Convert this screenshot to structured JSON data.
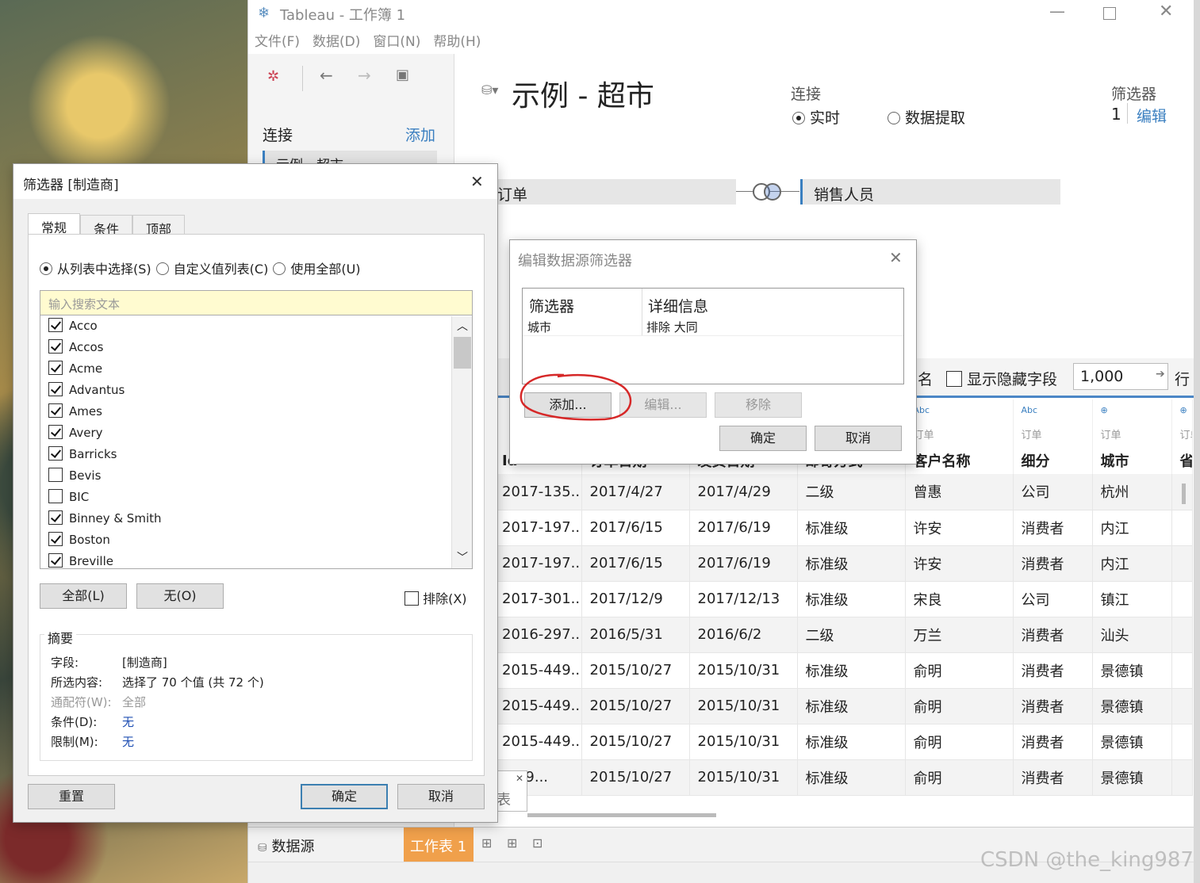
{
  "app": {
    "title": "Tableau - 工作簿 1",
    "menu": [
      "文件(F)",
      "数据(D)",
      "窗口(N)",
      "帮助(H)"
    ]
  },
  "left_panel": {
    "connect_label": "连接",
    "add_link": "添加",
    "datasource_item": "示例 - 超市"
  },
  "datasource": {
    "name": "示例 - 超市",
    "connection_label": "连接",
    "live": "实时",
    "extract": "数据提取",
    "filters_label": "筛选器",
    "filters_count": "1",
    "edit_link": "编辑",
    "table_left": "订单",
    "table_right": "销售人员"
  },
  "grid_toolbar": {
    "name_partial": "名",
    "show_hidden": "显示隐藏字段",
    "rows_value": "1,000",
    "rows_label": "行"
  },
  "grid": {
    "type_row": [
      "",
      "",
      "",
      "",
      "Abc",
      "Abc",
      "⊕",
      "⊕"
    ],
    "source_row": [
      "",
      "",
      "",
      "",
      "订单",
      "订单",
      "订单",
      "订单"
    ],
    "headers": [
      "Id",
      "订单日期",
      "发货日期",
      "邮寄方式",
      "客户名称",
      "细分",
      "城市",
      "省"
    ],
    "rows": [
      [
        "2017-135...",
        "2017/4/27",
        "2017/4/29",
        "二级",
        "曾惠",
        "公司",
        "杭州"
      ],
      [
        "2017-197...",
        "2017/6/15",
        "2017/6/19",
        "标准级",
        "许安",
        "消费者",
        "内江"
      ],
      [
        "2017-197...",
        "2017/6/15",
        "2017/6/19",
        "标准级",
        "许安",
        "消费者",
        "内江"
      ],
      [
        "2017-301...",
        "2017/12/9",
        "2017/12/13",
        "标准级",
        "宋良",
        "公司",
        "镇江"
      ],
      [
        "2016-297...",
        "2016/5/31",
        "2016/6/2",
        "二级",
        "万兰",
        "消费者",
        "汕头"
      ],
      [
        "2015-449...",
        "2015/10/27",
        "2015/10/31",
        "标准级",
        "俞明",
        "消费者",
        "景德镇"
      ],
      [
        "2015-449...",
        "2015/10/27",
        "2015/10/31",
        "标准级",
        "俞明",
        "消费者",
        "景德镇"
      ],
      [
        "2015-449...",
        "2015/10/27",
        "2015/10/31",
        "标准级",
        "俞明",
        "消费者",
        "景德镇"
      ],
      [
        "-449...",
        "2015/10/27",
        "2015/10/31",
        "标准级",
        "俞明",
        "消费者",
        "景德镇"
      ]
    ]
  },
  "bottom_tabs": {
    "datasource": "数据源",
    "sheet": "工作表 1",
    "tooltip_fragment": "表"
  },
  "filter_dialog": {
    "title": "筛选器 [制造商]",
    "tabs": [
      "常规",
      "条件",
      "顶部"
    ],
    "modes": [
      "从列表中选择(S)",
      "自定义值列表(C)",
      "使用全部(U)"
    ],
    "search_placeholder": "输入搜索文本",
    "items": [
      {
        "label": "Acco",
        "checked": true
      },
      {
        "label": "Accos",
        "checked": true
      },
      {
        "label": "Acme",
        "checked": true
      },
      {
        "label": "Advantus",
        "checked": true
      },
      {
        "label": "Ames",
        "checked": true
      },
      {
        "label": "Avery",
        "checked": true
      },
      {
        "label": "Barricks",
        "checked": true
      },
      {
        "label": "Bevis",
        "checked": false
      },
      {
        "label": "BIC",
        "checked": false
      },
      {
        "label": "Binney & Smith",
        "checked": true
      },
      {
        "label": "Boston",
        "checked": true
      },
      {
        "label": "Breville",
        "checked": true
      }
    ],
    "all_button": "全部(L)",
    "none_button": "无(O)",
    "exclude": "排除(X)",
    "summary_title": "摘要",
    "summary": [
      {
        "key": "字段:",
        "value": "[制造商]",
        "muted": false
      },
      {
        "key": "所选内容:",
        "value": "选择了 70 个值 (共 72 个)",
        "muted": false
      },
      {
        "key": "通配符(W):",
        "value": "全部",
        "muted": true
      },
      {
        "key": "条件(D):",
        "value": "无",
        "muted": false,
        "blue": true
      },
      {
        "key": "限制(M):",
        "value": "无",
        "muted": false,
        "blue": true
      }
    ],
    "reset": "重置",
    "ok": "确定",
    "cancel": "取消"
  },
  "ds_filter_dialog": {
    "title": "编辑数据源筛选器",
    "col_filter": "筛选器",
    "col_detail": "详细信息",
    "row_filter": "城市",
    "row_detail": "排除 大同",
    "add": "添加...",
    "edit": "编辑...",
    "remove": "移除",
    "ok": "确定",
    "cancel": "取消"
  },
  "watermark": "CSDN @the_king987"
}
